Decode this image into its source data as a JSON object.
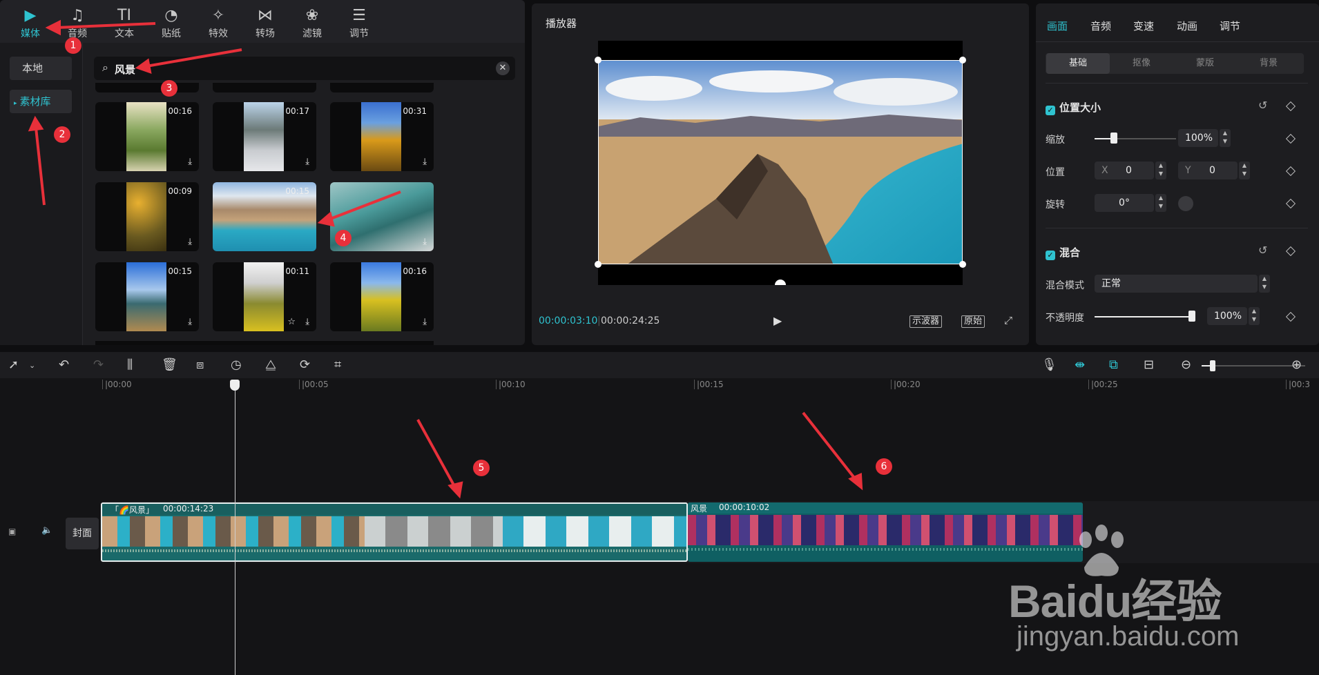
{
  "top_tools": [
    {
      "label": "媒体",
      "icon": "media-icon"
    },
    {
      "label": "音频",
      "icon": "audio-icon"
    },
    {
      "label": "文本",
      "icon": "text-icon"
    },
    {
      "label": "贴纸",
      "icon": "sticker-icon"
    },
    {
      "label": "特效",
      "icon": "effects-icon"
    },
    {
      "label": "转场",
      "icon": "transition-icon"
    },
    {
      "label": "滤镜",
      "icon": "filter-icon"
    },
    {
      "label": "调节",
      "icon": "adjust-icon"
    }
  ],
  "sidebar": {
    "local": "本地",
    "library": "素材库"
  },
  "search": {
    "value": "风景"
  },
  "thumbs": [
    {
      "dur": "00:16"
    },
    {
      "dur": "00:17"
    },
    {
      "dur": "00:31"
    },
    {
      "dur": "00:09"
    },
    {
      "dur": "00:15"
    },
    {
      "dur": ""
    },
    {
      "dur": "00:15"
    },
    {
      "dur": "00:11"
    },
    {
      "dur": "00:16"
    }
  ],
  "player": {
    "title": "播放器",
    "time_current": "00:00:03:10",
    "time_total": "00:00:24:25",
    "scope_label": "示波器",
    "original_label": "原始"
  },
  "props": {
    "tabs": [
      "画面",
      "音频",
      "变速",
      "动画",
      "调节"
    ],
    "segments": [
      "基础",
      "抠像",
      "蒙版",
      "背景"
    ],
    "pos_size_title": "位置大小",
    "scale_label": "缩放",
    "scale_value": "100%",
    "position_label": "位置",
    "x_label": "X",
    "x_value": "0",
    "y_label": "Y",
    "y_value": "0",
    "rotate_label": "旋转",
    "rotate_value": "0°",
    "blend_title": "混合",
    "blend_mode_label": "混合模式",
    "blend_mode_value": "正常",
    "opacity_label": "不透明度",
    "opacity_value": "100%"
  },
  "ruler": [
    "|00:00",
    "|00:05",
    "|00:10",
    "|00:15",
    "|00:20",
    "|00:25",
    "|00:3"
  ],
  "track": {
    "cover_label": "封面"
  },
  "clips": [
    {
      "label": "「🌈风景」",
      "duration": "00:00:14:23"
    },
    {
      "label": "风景",
      "duration": "00:00:10:02"
    }
  ],
  "annotations": [
    "1",
    "2",
    "3",
    "4",
    "5",
    "6"
  ],
  "watermark": {
    "brand": "Baidu经验",
    "url": "jingyan.baidu.com"
  },
  "colors": {
    "accent": "#2fc3d0",
    "annotation": "#e8303a"
  }
}
